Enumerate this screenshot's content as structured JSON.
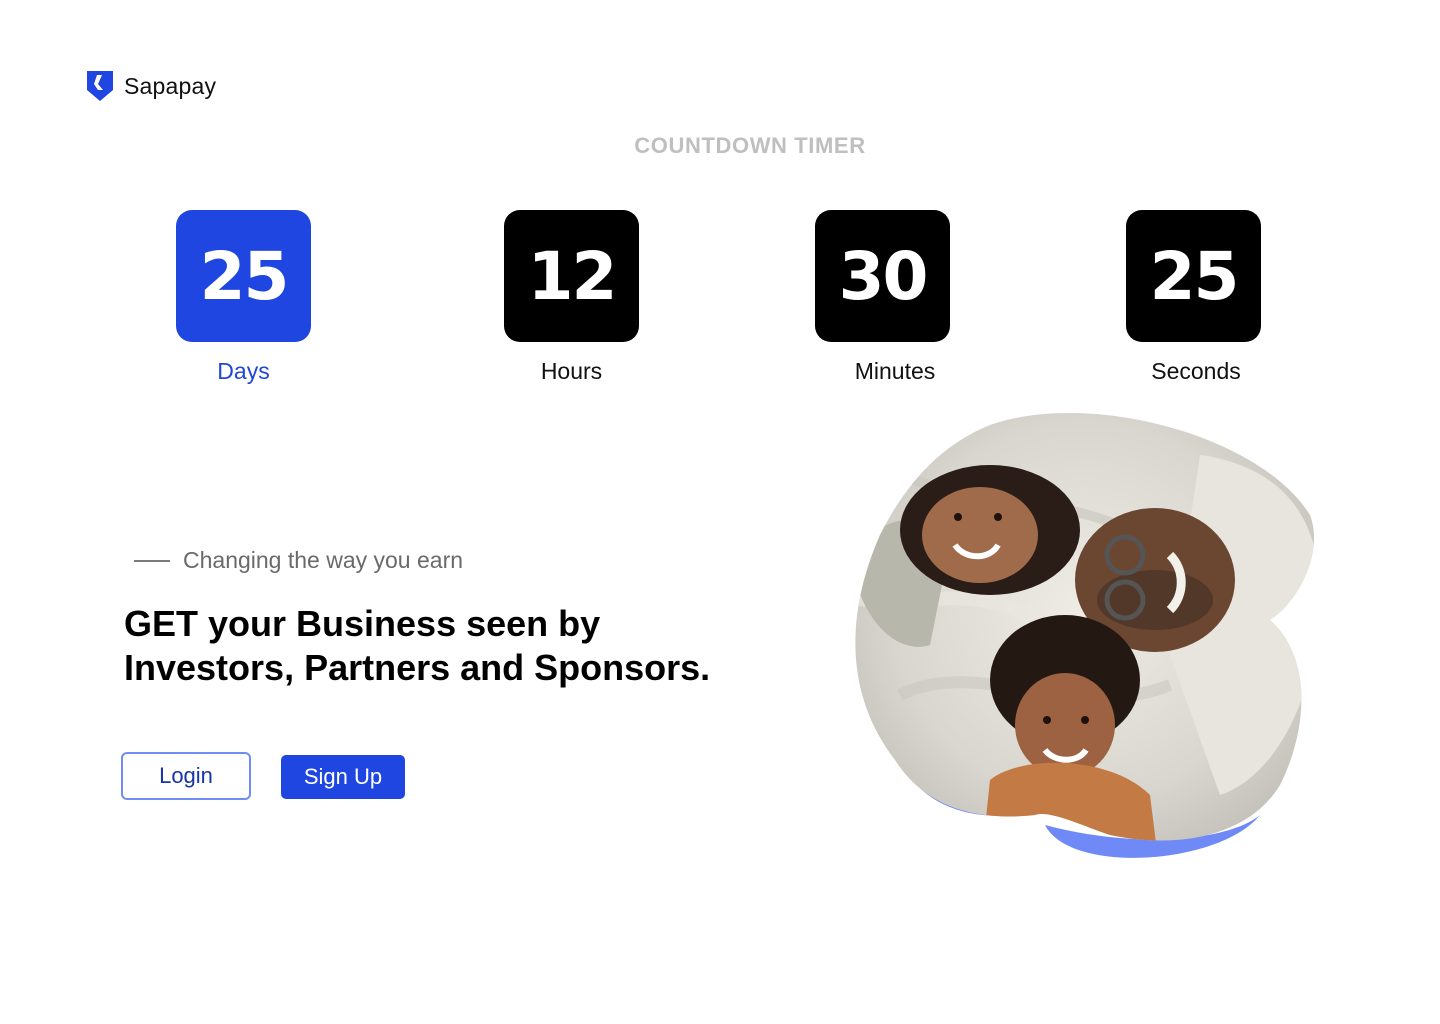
{
  "brand": {
    "name": "Sapapay",
    "logo_icon": "shield-icon",
    "color": "#1f46e0"
  },
  "timer": {
    "title": "COUNTDOWN TIMER",
    "units": [
      {
        "value": "25",
        "label": "Days",
        "active": true
      },
      {
        "value": "12",
        "label": "Hours",
        "active": false
      },
      {
        "value": "30",
        "label": "Minutes",
        "active": false
      },
      {
        "value": "25",
        "label": "Seconds",
        "active": false
      }
    ]
  },
  "hero": {
    "tagline": "Changing the way you earn",
    "headline_line1": "GET your Business seen by",
    "headline_line2": "Investors, Partners and Sponsors.",
    "image_icon": "family-photo"
  },
  "actions": {
    "login_label": "Login",
    "signup_label": "Sign Up"
  },
  "colors": {
    "accent": "#1f46e0",
    "tile_dark": "#000000",
    "title_gray": "#bfbfbf",
    "blob_blue": "#6f8af7"
  }
}
